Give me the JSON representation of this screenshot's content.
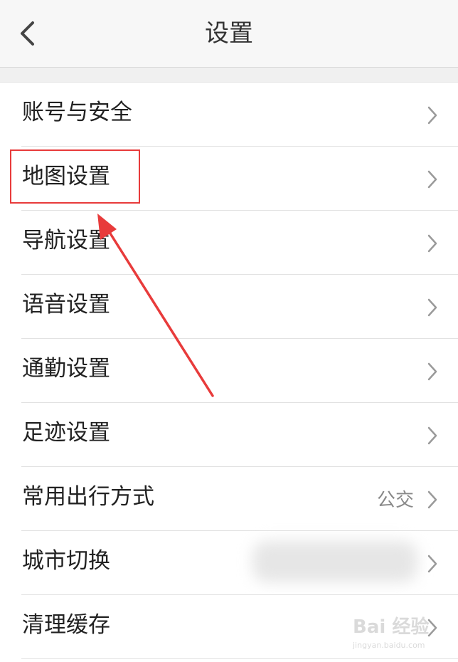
{
  "header": {
    "title": "设置",
    "back_icon": "chevron-left-icon"
  },
  "settings": {
    "items": [
      {
        "label": "账号与安全"
      },
      {
        "label": "地图设置"
      },
      {
        "label": "导航设置"
      },
      {
        "label": "语音设置"
      },
      {
        "label": "通勤设置"
      },
      {
        "label": "足迹设置"
      },
      {
        "label": "常用出行方式",
        "value": "公交"
      },
      {
        "label": "城市切换"
      },
      {
        "label": "清理缓存"
      }
    ]
  },
  "annotation": {
    "highlight_color": "#e83b3b"
  },
  "watermark": {
    "logo": "Bai 经验",
    "url": "jingyan.baidu.com"
  }
}
